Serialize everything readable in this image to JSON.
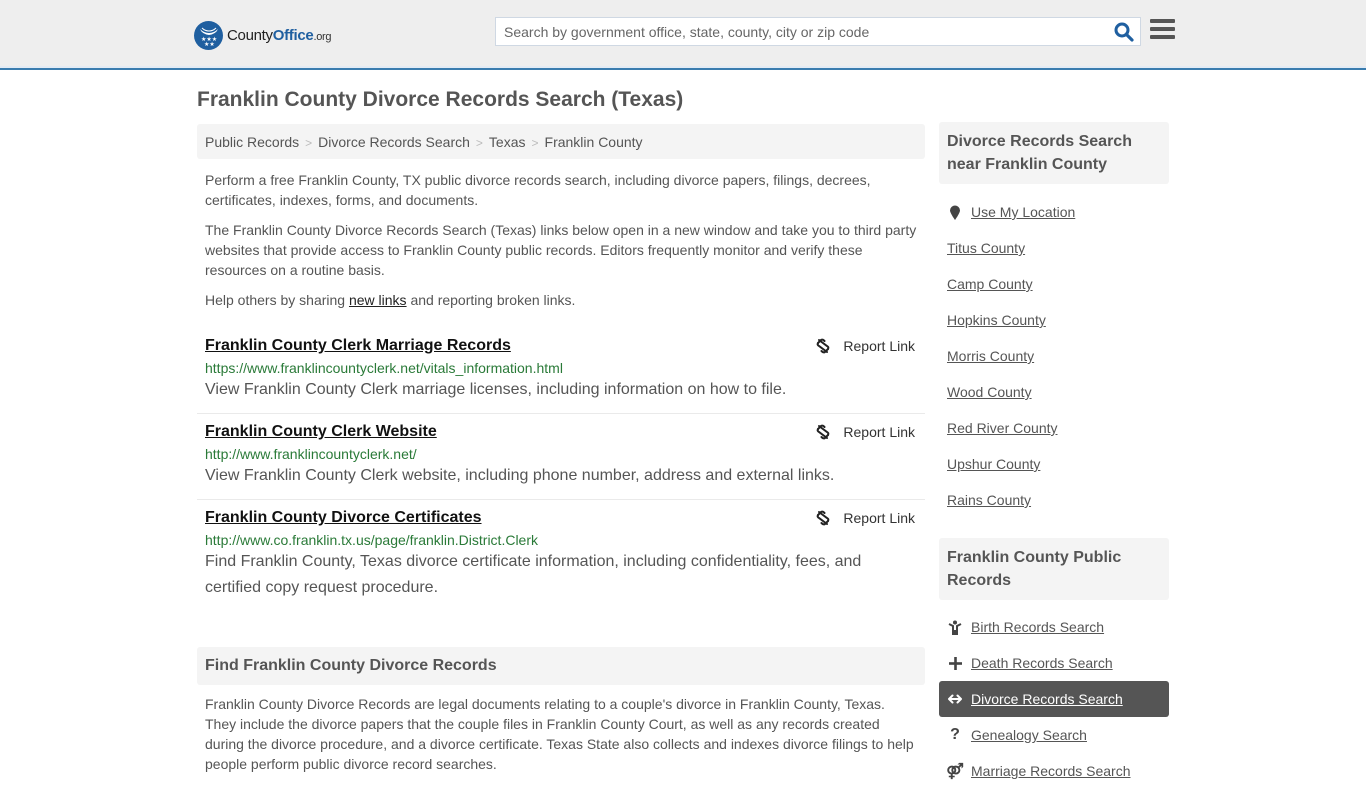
{
  "header": {
    "logo": {
      "name_part1": "County",
      "name_part2": "Office",
      "name_suffix": ".org"
    },
    "search": {
      "placeholder": "Search by government office, state, county, city or zip code",
      "value": ""
    },
    "colors": {
      "brand": "#1f5fa0",
      "accent_border": "#3a7cae"
    }
  },
  "page": {
    "title": "Franklin County Divorce Records Search (Texas)"
  },
  "breadcrumb": [
    {
      "label": "Public Records"
    },
    {
      "label": "Divorce Records Search"
    },
    {
      "label": "Texas"
    },
    {
      "label": "Franklin County"
    }
  ],
  "intro": {
    "p1": "Perform a free Franklin County, TX public divorce records search, including divorce papers, filings, decrees, certificates, indexes, forms, and documents.",
    "p2": "The Franklin County Divorce Records Search (Texas) links below open in a new window and take you to third party websites that provide access to Franklin County public records. Editors frequently monitor and verify these resources on a routine basis.",
    "p3_before": "Help others by sharing ",
    "p3_link": "new links",
    "p3_after": " and reporting broken links."
  },
  "links": [
    {
      "title": "Franklin County Clerk Marriage Records",
      "url": "https://www.franklincountyclerk.net/vitals_information.html",
      "description": "View Franklin County Clerk marriage licenses, including information on how to file.",
      "report_label": "Report Link"
    },
    {
      "title": "Franklin County Clerk Website",
      "url": "http://www.franklincountyclerk.net/",
      "description": "View Franklin County Clerk website, including phone number, address and external links.",
      "report_label": "Report Link"
    },
    {
      "title": "Franklin County Divorce Certificates",
      "url": "http://www.co.franklin.tx.us/page/franklin.District.Clerk",
      "description": "Find Franklin County, Texas divorce certificate information, including confidentiality, fees, and certified copy request procedure.",
      "report_label": "Report Link"
    }
  ],
  "find_section": {
    "heading": "Find Franklin County Divorce Records",
    "text": "Franklin County Divorce Records are legal documents relating to a couple's divorce in Franklin County, Texas. They include the divorce papers that the couple files in Franklin County Court, as well as any records created during the divorce procedure, and a divorce certificate. Texas State also collects and indexes divorce filings to help people perform public divorce record searches."
  },
  "sidebar": {
    "nearby": {
      "heading": "Divorce Records Search near Franklin County",
      "use_location": "Use My Location",
      "counties": [
        "Titus County",
        "Camp County",
        "Hopkins County",
        "Morris County",
        "Wood County",
        "Red River County",
        "Upshur County",
        "Rains County"
      ]
    },
    "public_records": {
      "heading": "Franklin County Public Records",
      "items": [
        {
          "label": "Birth Records Search",
          "icon": "child-icon",
          "active": false
        },
        {
          "label": "Death Records Search",
          "icon": "plus-icon",
          "active": false
        },
        {
          "label": "Divorce Records Search",
          "icon": "arrows-horizontal-icon",
          "active": true
        },
        {
          "label": "Genealogy Search",
          "icon": "question-icon",
          "active": false
        },
        {
          "label": "Marriage Records Search",
          "icon": "gender-icon",
          "active": false
        }
      ]
    }
  }
}
